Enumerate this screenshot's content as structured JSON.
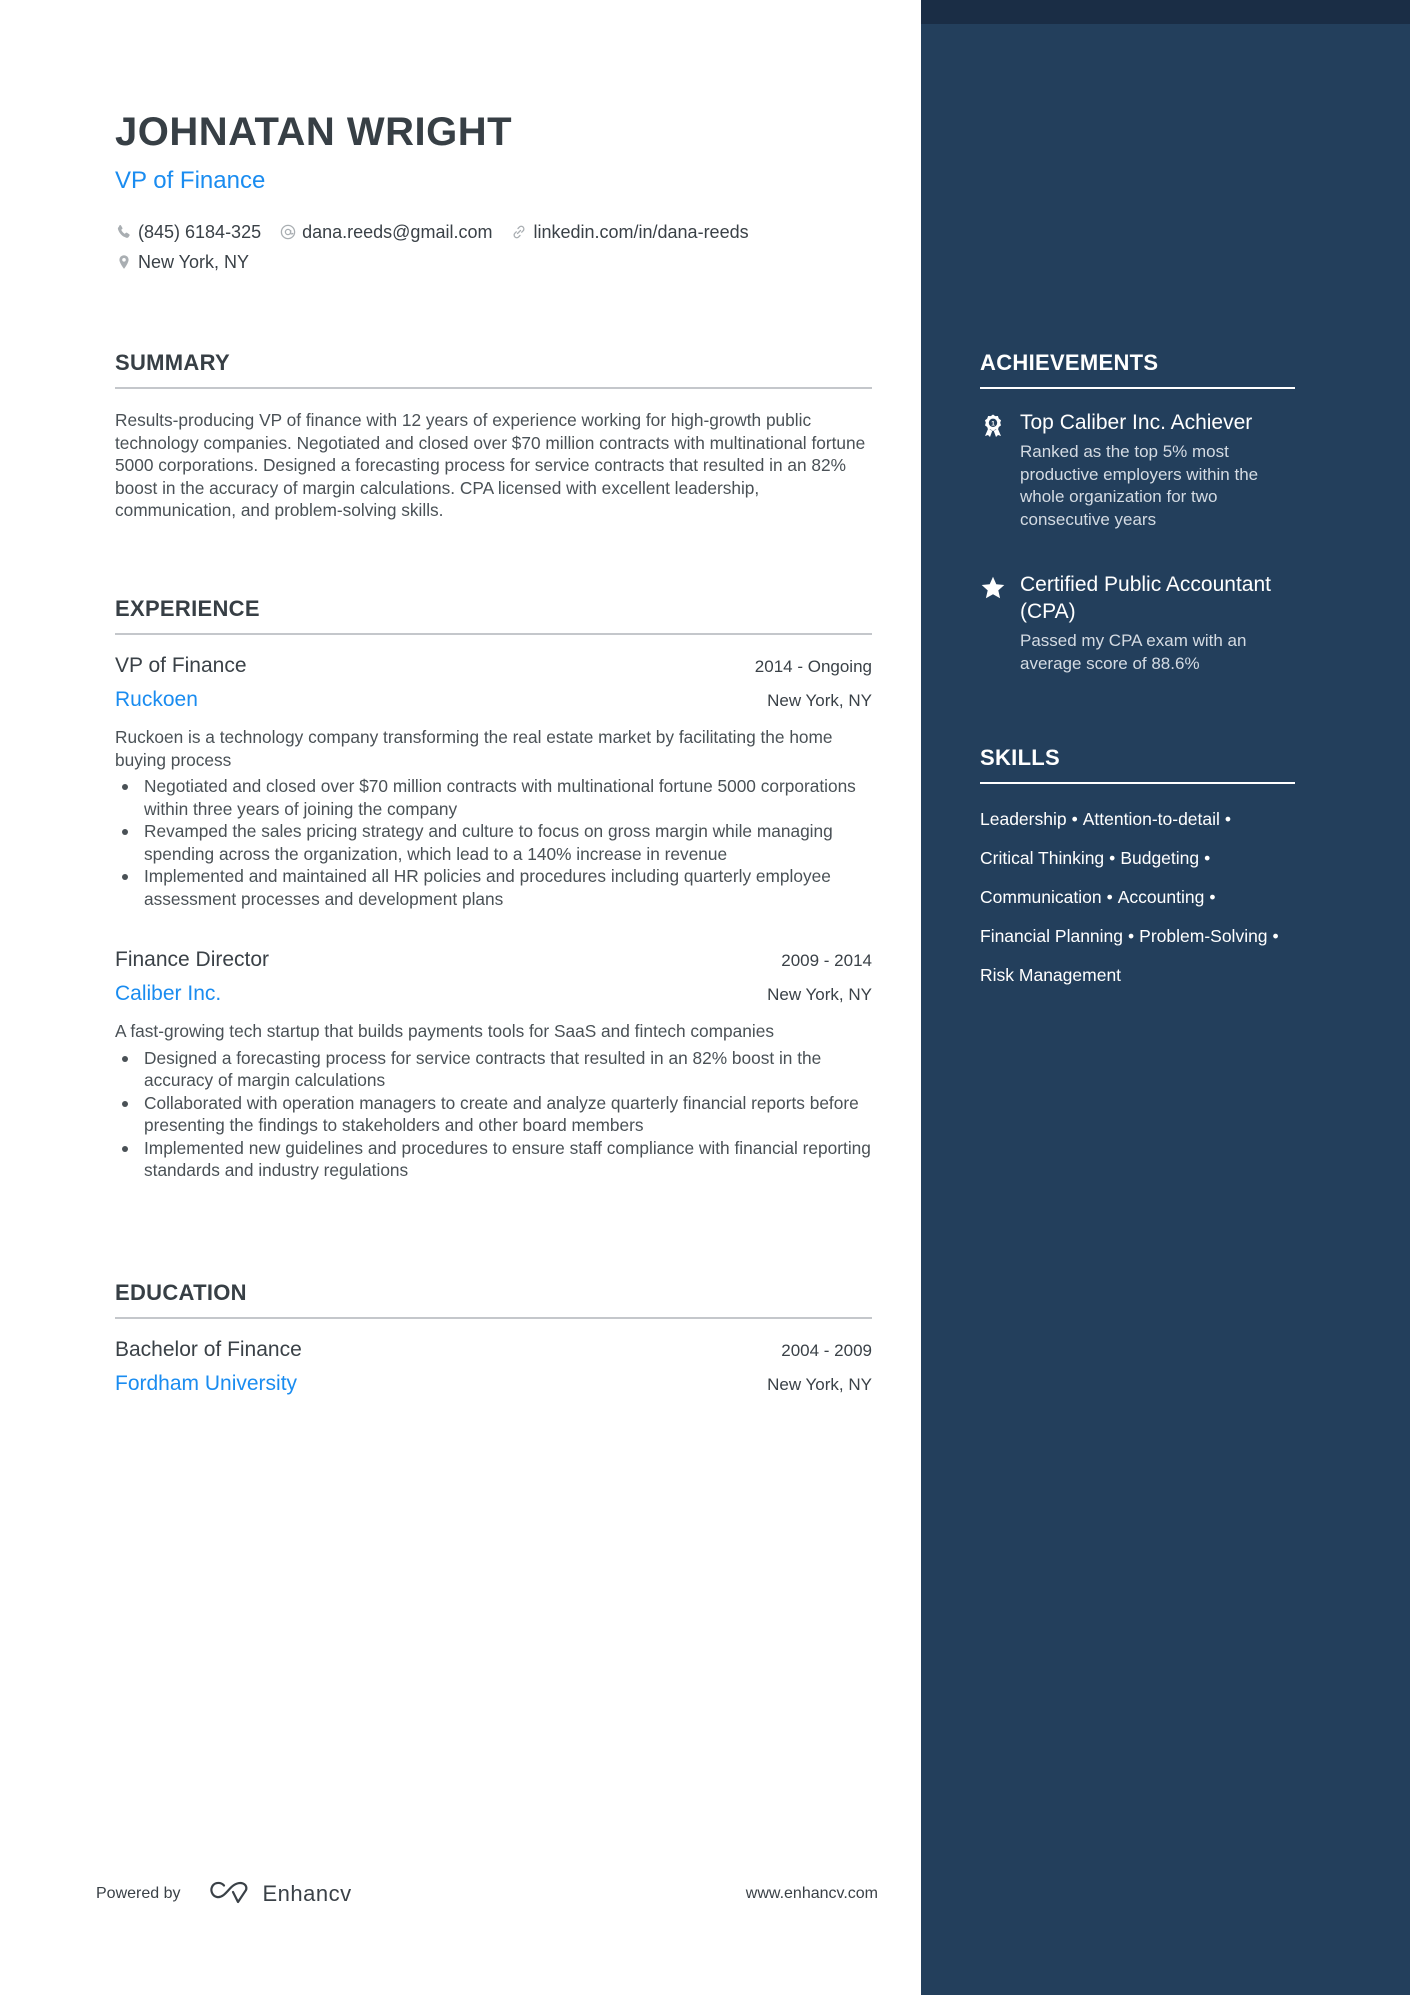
{
  "header": {
    "name": "JOHNATAN WRIGHT",
    "title": "VP of Finance",
    "contacts": [
      {
        "icon": "phone-icon",
        "text": "(845) 6184-325"
      },
      {
        "icon": "at-icon",
        "text": "dana.reeds@gmail.com"
      },
      {
        "icon": "link-icon",
        "text": "linkedin.com/in/dana-reeds"
      },
      {
        "icon": "location-pin-icon",
        "text": "New York, NY"
      }
    ]
  },
  "summary": {
    "heading": "SUMMARY",
    "text": "Results-producing VP of finance with 12 years of experience working for high-growth public technology companies. Negotiated and closed over $70 million contracts with multinational fortune 5000 corporations. Designed a forecasting process for service contracts that resulted in an 82% boost in the accuracy of margin calculations. CPA licensed with excellent leadership, communication, and problem-solving skills."
  },
  "experience": {
    "heading": "EXPERIENCE",
    "jobs": [
      {
        "role": "VP of Finance",
        "dates": "2014 - Ongoing",
        "company": "Ruckoen",
        "location": "New York, NY",
        "description": "Ruckoen is a technology company transforming the real estate market by facilitating the home buying process",
        "bullets": [
          "Negotiated and closed over $70 million contracts with multinational fortune 5000 corporations within three years of joining the company",
          "Revamped the sales pricing strategy and culture to focus on gross margin while managing spending across the organization, which lead to a 140% increase in revenue",
          "Implemented and maintained all HR policies and procedures including quarterly employee assessment processes and development plans"
        ]
      },
      {
        "role": "Finance Director",
        "dates": "2009 - 2014",
        "company": "Caliber Inc.",
        "location": "New York, NY",
        "description": "A fast-growing tech startup that builds payments tools for SaaS and fintech companies",
        "bullets": [
          "Designed a forecasting process for service contracts that resulted in an 82% boost in the accuracy of margin calculations",
          "Collaborated with operation managers to create and analyze quarterly financial reports before presenting the findings to stakeholders and other board members",
          "Implemented new guidelines and procedures to ensure staff compliance with financial reporting standards and industry regulations"
        ]
      }
    ]
  },
  "education": {
    "heading": "EDUCATION",
    "items": [
      {
        "degree": "Bachelor of Finance",
        "dates": "2004 - 2009",
        "school": "Fordham University",
        "location": "New York, NY"
      }
    ]
  },
  "achievements": {
    "heading": "ACHIEVEMENTS",
    "items": [
      {
        "icon": "award-ribbon-icon",
        "title": "Top Caliber Inc. Achiever",
        "description": "Ranked as the top 5% most productive employers within the whole organization for two consecutive years"
      },
      {
        "icon": "star-icon",
        "title": "Certified Public Accountant (CPA)",
        "description": "Passed my CPA exam with an average score of 88.6%"
      }
    ]
  },
  "skills": {
    "heading": "SKILLS",
    "separator": "•",
    "lines": [
      [
        "Leadership",
        "Attention-to-detail"
      ],
      [
        "Critical Thinking",
        "Budgeting"
      ],
      [
        "Communication",
        "Accounting"
      ],
      [
        "Financial Planning",
        "Problem-Solving"
      ],
      [
        "Risk Management"
      ]
    ]
  },
  "footer": {
    "powered_by": "Powered by",
    "brand": "Enhancv",
    "website": "www.enhancv.com"
  },
  "colors": {
    "accent": "#1a8cf0",
    "sidebar": "#233f5c",
    "sidebar_top": "#1a2d45",
    "text": "#3a4147"
  }
}
